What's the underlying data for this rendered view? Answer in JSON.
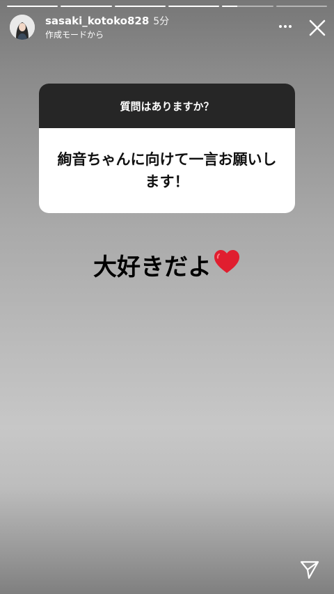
{
  "story": {
    "progress_segments": [
      {
        "fill": 1
      },
      {
        "fill": 1
      },
      {
        "fill": 1
      },
      {
        "fill": 1
      },
      {
        "fill": 0.3
      },
      {
        "fill": 0
      }
    ],
    "username": "sasaki_kotoko828",
    "time_ago": "5分",
    "subtitle": "作成モードから"
  },
  "question_sticker": {
    "header": "質問はありますか？",
    "question": "絢音ちゃんに向けて一言お願いします！"
  },
  "answer": {
    "text": "大好きだよ",
    "emoji": "red-heart"
  },
  "icons": {
    "more": "more-dots-icon",
    "close": "close-icon",
    "send": "send-icon"
  },
  "colors": {
    "sticker_header_bg": "#262626",
    "heart": "#e01e2f"
  }
}
